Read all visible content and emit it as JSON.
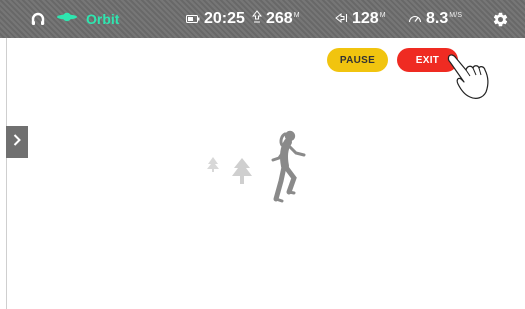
{
  "status_bar": {
    "app_name": "Orbit",
    "timer": "20:25",
    "elevation": {
      "value": "268",
      "unit": "M"
    },
    "distance": {
      "value": "128",
      "unit": "M"
    },
    "speed": {
      "value": "8.3",
      "unit": "M/S"
    },
    "icons": [
      "headphones-icon",
      "planet-icon",
      "battery-icon",
      "elevation-icon",
      "distance-icon",
      "speedometer-icon",
      "gear-icon"
    ]
  },
  "controls": {
    "pause_label": "PAUSE",
    "exit_label": "EXIT"
  },
  "sidebar_toggle": {
    "icon": "chevron-right-icon"
  },
  "scene": {
    "figures": [
      "tree-icon",
      "tree-icon",
      "runner-figure",
      "pointing-hand-icon"
    ]
  },
  "colors": {
    "status_bar": "#6e6e6e",
    "accent": "#2ee6b0",
    "pause": "#f1c40f",
    "exit": "#ef2b22",
    "figure": "#8a8a8a"
  }
}
